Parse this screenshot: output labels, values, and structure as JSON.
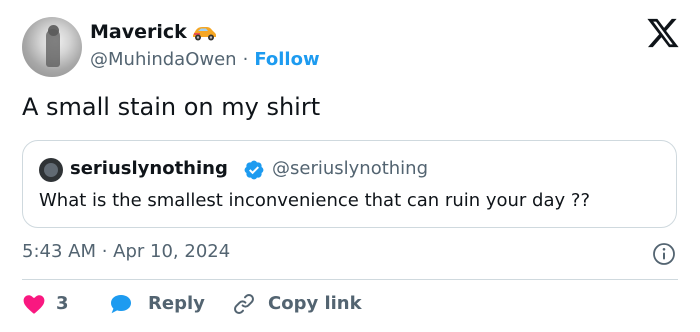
{
  "author": {
    "name": "Maverick",
    "handle": "@MuhindaOwen",
    "separator": "·",
    "follow_label": "Follow"
  },
  "tweet": {
    "text": "A small stain on my shirt",
    "timestamp": "5:43 AM · Apr 10, 2024"
  },
  "quoted": {
    "name": "seriuslynothing",
    "handle": "@seriuslynothing",
    "text": "What is the smallest inconvenience that can ruin your day ??"
  },
  "actions": {
    "like_count": "3",
    "reply_label": "Reply",
    "copy_label": "Copy link"
  },
  "icons": {
    "logo": "x-logo-icon",
    "emoji": "race-car-icon",
    "verified": "verified-badge-icon",
    "info": "info-icon",
    "like": "heart-icon",
    "reply": "speech-bubble-icon",
    "copy": "link-icon"
  },
  "colors": {
    "accent": "#1d9bf0",
    "like": "#f91880",
    "text": "#0f1419",
    "secondary": "#536471",
    "border": "#cfd9de"
  }
}
